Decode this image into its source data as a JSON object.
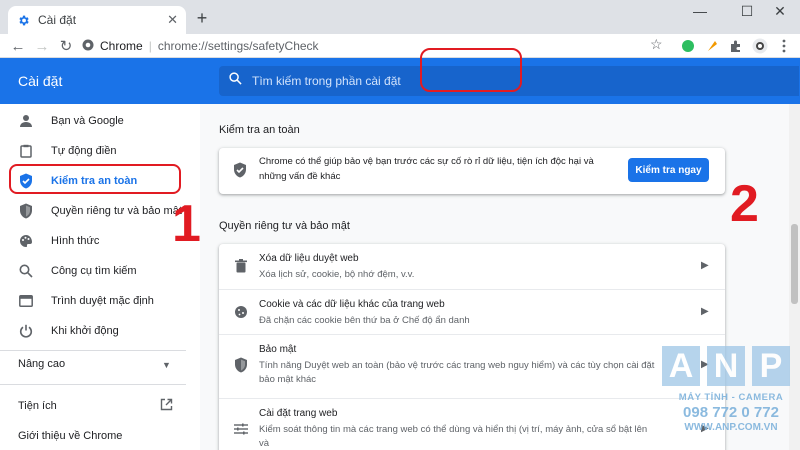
{
  "browser": {
    "tab_title": "Cài đặt",
    "new_tab": "+",
    "omnibox_site": "Chrome",
    "omnibox_url": "chrome://settings/safetyCheck",
    "minimize": "—",
    "maximize": "☐",
    "close": "✕"
  },
  "header": {
    "title": "Cài đặt",
    "search_placeholder": "Tìm kiếm trong phần cài đặt"
  },
  "sidebar": {
    "items": [
      {
        "label": "Bạn và Google",
        "icon": "person-icon"
      },
      {
        "label": "Tự động điền",
        "icon": "clipboard-icon"
      },
      {
        "label": "Kiểm tra an toàn",
        "icon": "shield-check-icon",
        "active": true
      },
      {
        "label": "Quyền riêng tư và bảo mật",
        "icon": "shield-icon"
      },
      {
        "label": "Hình thức",
        "icon": "palette-icon"
      },
      {
        "label": "Công cụ tìm kiếm",
        "icon": "search-icon"
      },
      {
        "label": "Trình duyệt mặc định",
        "icon": "browser-icon"
      },
      {
        "label": "Khi khởi động",
        "icon": "power-icon"
      }
    ],
    "advanced": "Nâng cao",
    "extensions": "Tiện ích",
    "about": "Giới thiệu về Chrome"
  },
  "main": {
    "safety_title": "Kiểm tra an toàn",
    "safety_text": "Chrome có thể giúp bảo vệ bạn trước các sự cố rò rỉ dữ liệu, tiện ích độc hại và những vấn đề khác",
    "safety_button": "Kiểm tra ngay",
    "privacy_title": "Quyền riêng tư và bảo mật",
    "rows": [
      {
        "title": "Xóa dữ liệu duyệt web",
        "desc": "Xóa lịch sử, cookie, bộ nhớ đệm, v.v.",
        "icon": "trash-icon"
      },
      {
        "title": "Cookie và các dữ liệu khác của trang web",
        "desc": "Đã chặn các cookie bên thứ ba ở Chế độ ẩn danh",
        "icon": "cookie-icon"
      },
      {
        "title": "Bảo mật",
        "desc": "Tính năng Duyệt web an toàn (bảo vệ trước các trang web nguy hiểm) và các tùy chọn cài đặt bảo mật khác",
        "icon": "shield-icon"
      },
      {
        "title": "Cài đặt trang web",
        "desc": "Kiểm soát thông tin mà các trang web có thể dùng và hiển thị (vị trí, máy ảnh, cửa sổ bật lên và",
        "icon": "sliders-icon"
      }
    ]
  },
  "annotations": {
    "step1": "1",
    "step2": "2"
  },
  "watermark": {
    "letters": [
      "A",
      "N",
      "P"
    ],
    "subtitle": "MÁY TÍNH - CAMERA",
    "phone": "098 772 0 772",
    "website": "WWW.ANP.COM.VN"
  },
  "colors": {
    "accent": "#1a73e8",
    "annotation": "#e11b22"
  }
}
